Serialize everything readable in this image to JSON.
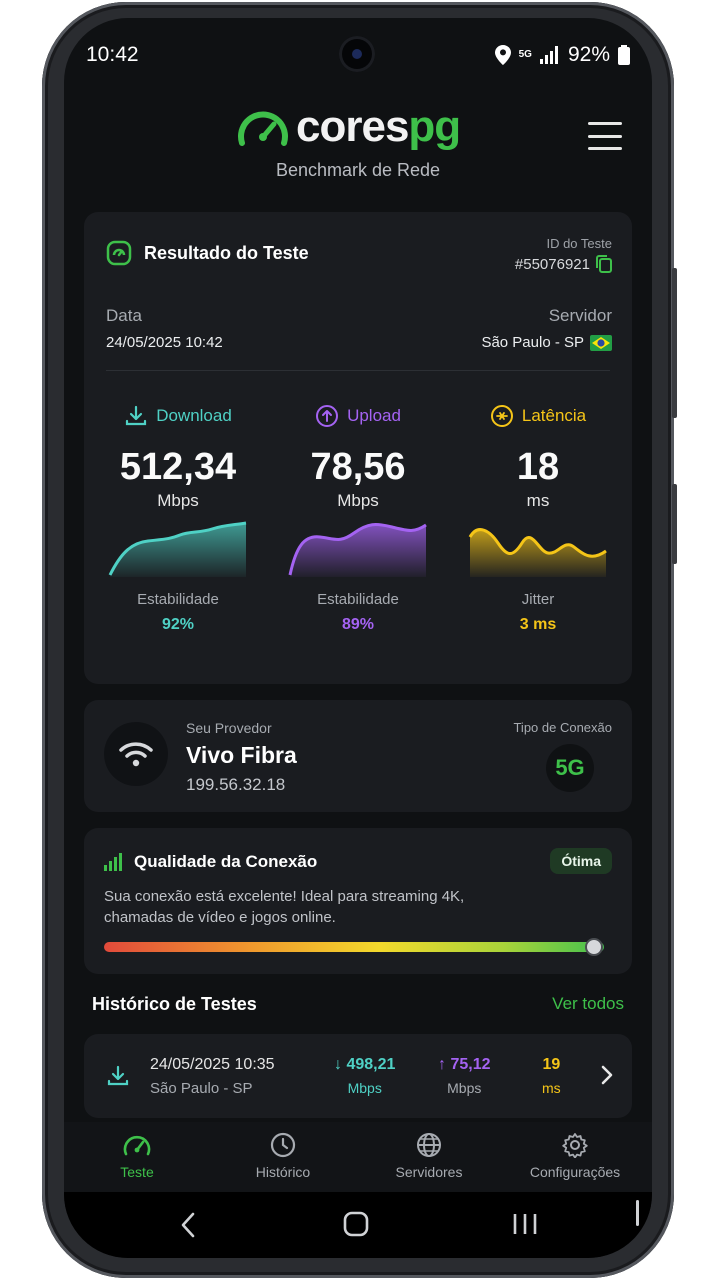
{
  "status_bar": {
    "time": "10:42",
    "network": "5G",
    "battery": "92%"
  },
  "header": {
    "logo_part1": "cores",
    "logo_part2": "pg",
    "subtitle": "Benchmark de Rede"
  },
  "result": {
    "title": "Resultado do Teste",
    "id_label": "ID do Teste",
    "id_value": "#55076921",
    "date_label": "Data",
    "date_value": "24/05/2025 10:42",
    "server_label": "Servidor",
    "server_value": "São Paulo - SP"
  },
  "metrics": [
    {
      "label": "Download",
      "value": "512,34",
      "unit": "Mbps",
      "sub_label": "Estabilidade",
      "sub_value": "92%",
      "color": "#4fd1c5"
    },
    {
      "label": "Upload",
      "value": "78,56",
      "unit": "Mbps",
      "sub_label": "Estabilidade",
      "sub_value": "89%",
      "color": "#a463f2"
    },
    {
      "label": "Latência",
      "value": "18",
      "unit": "ms",
      "sub_label": "Jitter",
      "sub_value": "3 ms",
      "color": "#f5c518"
    }
  ],
  "provider": {
    "label": "Seu Provedor",
    "name": "Vivo Fibra",
    "ip": "199.56.32.18",
    "conn_label": "Tipo de Conexão",
    "conn_value": "5G"
  },
  "quality": {
    "title": "Qualidade da Conexão",
    "badge": "Ótima",
    "description": "Sua conexão está excelente! Ideal para streaming 4K, chamadas de vídeo e jogos online.",
    "level": 0.98
  },
  "history": {
    "title": "Histórico de Testes",
    "link": "Ver todos",
    "items": [
      {
        "date": "24/05/2025 10:35",
        "location": "São Paulo - SP",
        "download": "498,21",
        "download_unit": "Mbps",
        "upload": "75,12",
        "upload_unit": "Mbps",
        "latency": "19",
        "latency_unit": "ms"
      }
    ]
  },
  "nav": [
    {
      "label": "Teste",
      "icon": "speedometer-icon",
      "active": true
    },
    {
      "label": "Histórico",
      "icon": "clock-icon",
      "active": false
    },
    {
      "label": "Servidores",
      "icon": "globe-icon",
      "active": false
    },
    {
      "label": "Configurações",
      "icon": "gear-icon",
      "active": false
    }
  ],
  "colors": {
    "accent": "#3ec04a",
    "background": "#0f1113",
    "card": "#1a1c20"
  }
}
